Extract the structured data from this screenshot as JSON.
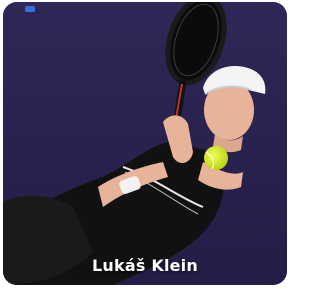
{
  "player": {
    "name": "Lukáš Klein",
    "photo_icon": "tennis-player-photo"
  },
  "colors": {
    "background": "#2a2350",
    "court_dark": "#1f1a44",
    "shirt": "#111111",
    "cap": "#f2f2f2",
    "ball": "#d7f021",
    "text": "#ffffff"
  }
}
